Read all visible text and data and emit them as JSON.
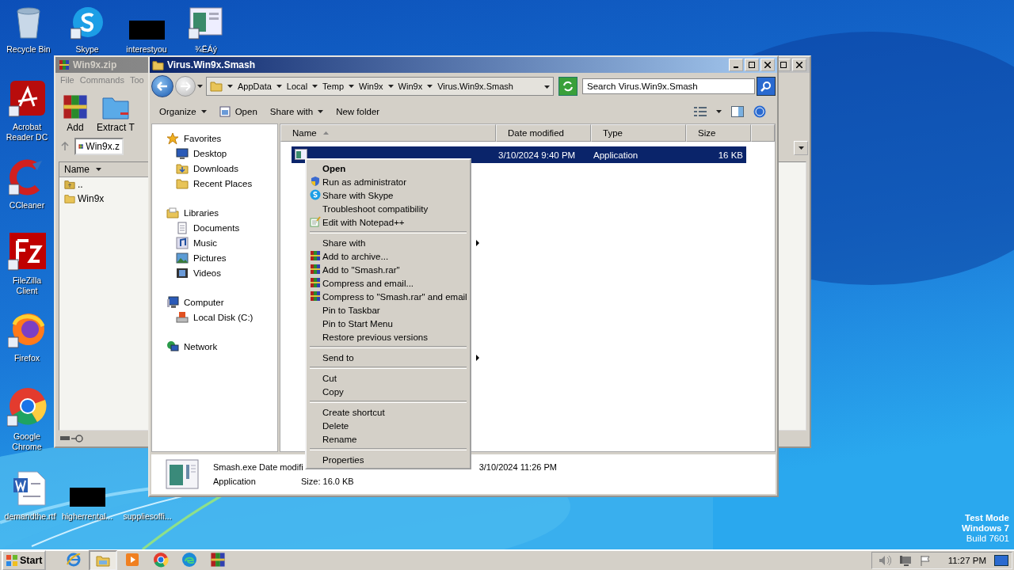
{
  "desktop_icons": [
    {
      "label": "Recycle Bin",
      "kind": "recycle"
    },
    {
      "label": "Skype",
      "kind": "skype"
    },
    {
      "label": "interestyou",
      "kind": "redacted"
    },
    {
      "label": "¾ËÁý",
      "kind": "window"
    },
    {
      "label": "Acrobat Reader DC",
      "kind": "acrobat"
    },
    {
      "label": "CCleaner",
      "kind": "ccleaner"
    },
    {
      "label": "FileZilla Client",
      "kind": "filezilla"
    },
    {
      "label": "Firefox",
      "kind": "firefox"
    },
    {
      "label": "Google Chrome",
      "kind": "chrome"
    },
    {
      "label": "demandthe.rtf",
      "kind": "word"
    },
    {
      "label": "higherrental...",
      "kind": "redacted"
    },
    {
      "label": "suppliesoffi...",
      "kind": "hidden"
    }
  ],
  "desktop_text": [
    "Test Mode",
    "Windows 7",
    "Build 7601"
  ],
  "archive_window": {
    "title": "Win9x.zip",
    "menu": [
      "File",
      "Commands",
      "Too"
    ],
    "toolbar": [
      "Add",
      "Extract T"
    ],
    "address": "Win9x.z",
    "columns": [
      "Name"
    ],
    "rows": [
      {
        "name": "..",
        "kind": "up"
      },
      {
        "name": "Win9x",
        "kind": "folder"
      }
    ]
  },
  "explorer": {
    "title": "Virus.Win9x.Smash",
    "breadcrumb": [
      "AppData",
      "Local",
      "Temp",
      "Win9x",
      "Win9x",
      "Virus.Win9x.Smash"
    ],
    "search": {
      "placeholder": "Search Virus.Win9x.Smash"
    },
    "toolbar": [
      {
        "label": "Organize",
        "kind": "menu"
      },
      {
        "label": "Open",
        "kind": "open"
      },
      {
        "label": "Share with",
        "kind": "menu"
      },
      {
        "label": "New folder",
        "kind": "plain"
      }
    ],
    "nav": [
      {
        "label": "Favorites",
        "kind": "star",
        "children": [
          {
            "label": "Desktop",
            "kind": "desktop"
          },
          {
            "label": "Downloads",
            "kind": "downloads"
          },
          {
            "label": "Recent Places",
            "kind": "recent"
          }
        ]
      },
      {
        "label": "Libraries",
        "kind": "library",
        "children": [
          {
            "label": "Documents",
            "kind": "documents"
          },
          {
            "label": "Music",
            "kind": "music"
          },
          {
            "label": "Pictures",
            "kind": "pictures"
          },
          {
            "label": "Videos",
            "kind": "videos"
          }
        ]
      },
      {
        "label": "Computer",
        "kind": "computer",
        "children": [
          {
            "label": "Local Disk (C:)",
            "kind": "disk"
          }
        ]
      },
      {
        "label": "Network",
        "kind": "network"
      }
    ],
    "columns": [
      "Name",
      "Date modified",
      "Type",
      "Size"
    ],
    "files": [
      {
        "date": "3/10/2024 9:40 PM",
        "type": "Application",
        "size": "16 KB",
        "selected": true
      }
    ],
    "details": {
      "name": "Smash.exe",
      "modified": "Date modifi",
      "created": "3/10/2024 11:26 PM",
      "type": "Application",
      "size": "Size: 16.0 KB"
    }
  },
  "context_menu": {
    "groups": [
      [
        {
          "label": "Open",
          "kind": "default"
        },
        {
          "label": "Run as administrator",
          "kind": "shield"
        },
        {
          "label": "Share with Skype",
          "kind": "skype"
        },
        {
          "label": "Troubleshoot compatibility",
          "kind": "plain"
        },
        {
          "label": "Edit with Notepad++",
          "kind": "notepad"
        }
      ],
      [
        {
          "label": "Share with",
          "kind": "submenu"
        },
        {
          "label": "Add to archive...",
          "kind": "rar"
        },
        {
          "label": "Add to \"Smash.rar\"",
          "kind": "rar"
        },
        {
          "label": "Compress and email...",
          "kind": "rar"
        },
        {
          "label": "Compress to \"Smash.rar\" and email",
          "kind": "rar"
        },
        {
          "label": "Pin to Taskbar",
          "kind": "plain"
        },
        {
          "label": "Pin to Start Menu",
          "kind": "plain"
        },
        {
          "label": "Restore previous versions",
          "kind": "plain"
        }
      ],
      [
        {
          "label": "Send to",
          "kind": "submenu"
        }
      ],
      [
        {
          "label": "Cut",
          "kind": "plain"
        },
        {
          "label": "Copy",
          "kind": "plain"
        }
      ],
      [
        {
          "label": "Create shortcut",
          "kind": "plain"
        },
        {
          "label": "Delete",
          "kind": "plain"
        },
        {
          "label": "Rename",
          "kind": "plain"
        }
      ],
      [
        {
          "label": "Properties",
          "kind": "plain"
        }
      ]
    ]
  },
  "taskbar": {
    "start": "Start",
    "apps": [
      {
        "kind": "ie",
        "selected": false
      },
      {
        "kind": "explorer",
        "selected": true
      },
      {
        "kind": "media",
        "selected": false
      },
      {
        "kind": "chrome",
        "selected": false
      },
      {
        "kind": "edge",
        "selected": false
      },
      {
        "kind": "rar",
        "selected": false
      }
    ],
    "clock": "11:27 PM"
  }
}
